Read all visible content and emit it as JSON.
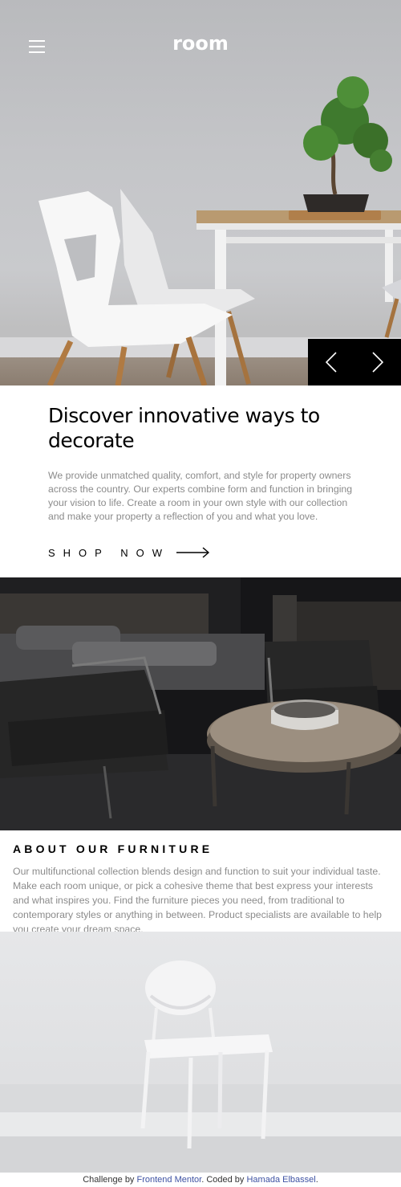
{
  "header": {
    "logo": "room",
    "menu_icon": "hamburger-icon"
  },
  "hero": {
    "prev_icon": "chevron-left-icon",
    "next_icon": "chevron-right-icon"
  },
  "discover": {
    "title": "Discover innovative ways to decorate",
    "text": "We provide unmatched quality, comfort, and style for property owners across the country. Our experts combine form and function in bringing your vision to life. Create a room in your own style with our collection and make your property a reflection of you and what you love.",
    "cta_label": "SHOP NOW",
    "cta_icon": "arrow-right-icon"
  },
  "about": {
    "title": "ABOUT OUR FURNITURE",
    "text": "Our multifunctional collection blends design and function to suit your individual taste. Make each room unique, or pick a cohesive theme that best express your interests and what inspires you. Find the furniture pieces you need, from traditional to contemporary styles or anything in between. Product specialists are available to help you create your dream space."
  },
  "footer": {
    "prefix": "Challenge by",
    "frontend_mentor": "Frontend Mentor",
    "middle": ". Coded by",
    "author": "Hamada Elbassel",
    "suffix": "."
  },
  "colors": {
    "link": "#3e52a3",
    "body_text": "#8b8b8b",
    "control_bg": "#000000"
  }
}
